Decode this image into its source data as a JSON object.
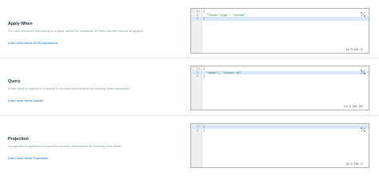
{
  "sections": [
    {
      "title": "Apply When",
      "description": "For each document returned by a request, define the conditions for when this filter should be applied.",
      "link": "Learn more about JSON expressions",
      "editor": {
        "lines": [
          {
            "num": "1",
            "fold": "▾",
            "text": "{"
          },
          {
            "num": "2",
            "fold": "",
            "text": "  \"%%user.type\": \"normal\""
          },
          {
            "num": "3",
            "fold": "",
            "text": "}"
          }
        ],
        "active_line": 3,
        "status": "Ln 3 Col 2"
      }
    },
    {
      "title": "Query",
      "description": "A filter query is applied to a request to increase performance by returning fewer documents.",
      "link": "Learn more about Queries",
      "editor": {
        "lines": [
          {
            "num": "1",
            "fold": "▾",
            "text": "{"
          },
          {
            "num": "2",
            "fold": "",
            "text": "  \"owner\": \"%%user.id\""
          },
          {
            "num": "3",
            "fold": "",
            "text": "}"
          }
        ],
        "active_line": 2,
        "status": "Ln 2 Col 25"
      }
    },
    {
      "title": "Projection",
      "description": "A projection is applied to a request to increase performance by returning fewer fields.",
      "link": "Learn more about Projections",
      "editor": {
        "lines": [
          {
            "num": "1",
            "fold": "▾",
            "text": "{"
          },
          {
            "num": "2",
            "fold": "",
            "text": "}"
          }
        ],
        "active_line": 1,
        "status": "Ln 1 Col 2"
      }
    }
  ]
}
